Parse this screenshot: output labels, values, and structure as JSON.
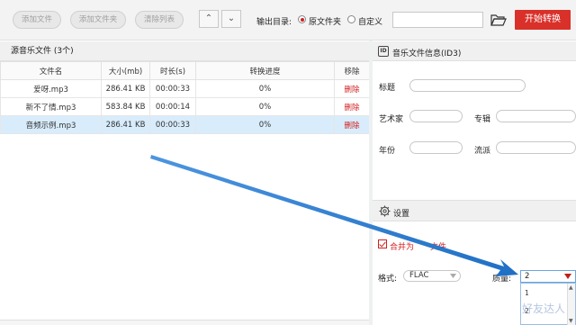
{
  "toolbar": {
    "add_file": "添加文件",
    "add_folder": "添加文件夹",
    "clear_list": "清除列表",
    "output_dir_label": "输出目录:",
    "option_original": "原文件夹",
    "option_custom": "自定义",
    "output_dir_value": "",
    "start_button": "开始转换"
  },
  "files_panel": {
    "title": "源音乐文件 (3个)",
    "columns": [
      "文件名",
      "大小(mb)",
      "时长(s)",
      "转换进度",
      "移除"
    ],
    "rows": [
      {
        "name": "爱呀.mp3",
        "size": "286.41 KB",
        "duration": "00:00:33",
        "progress": "0%",
        "remove": "删除",
        "selected": false
      },
      {
        "name": "新不了情.mp3",
        "size": "583.84 KB",
        "duration": "00:00:14",
        "progress": "0%",
        "remove": "删除",
        "selected": false
      },
      {
        "name": "音频示例.mp3",
        "size": "286.41 KB",
        "duration": "00:00:33",
        "progress": "0%",
        "remove": "删除",
        "selected": true
      }
    ]
  },
  "info_panel": {
    "title": "音乐文件信息(ID3)",
    "icon_text": "ID",
    "title_label": "标题",
    "artist_label": "艺术家",
    "album_label": "专辑",
    "year_label": "年份",
    "genre_label": "流派"
  },
  "settings": {
    "title": "设置",
    "merge_label_a": "合并为",
    "merge_label_b": "文件",
    "format_label": "格式:",
    "format_value": "FLAC",
    "quality_label": "质量:",
    "quality_value": "2",
    "quality_options": [
      "1",
      "2"
    ],
    "watermark": "好友达人"
  },
  "colors": {
    "accent_red": "#d9302a",
    "arrow_blue": "#2f7fd0",
    "selected_row": "#d8ecfb"
  }
}
